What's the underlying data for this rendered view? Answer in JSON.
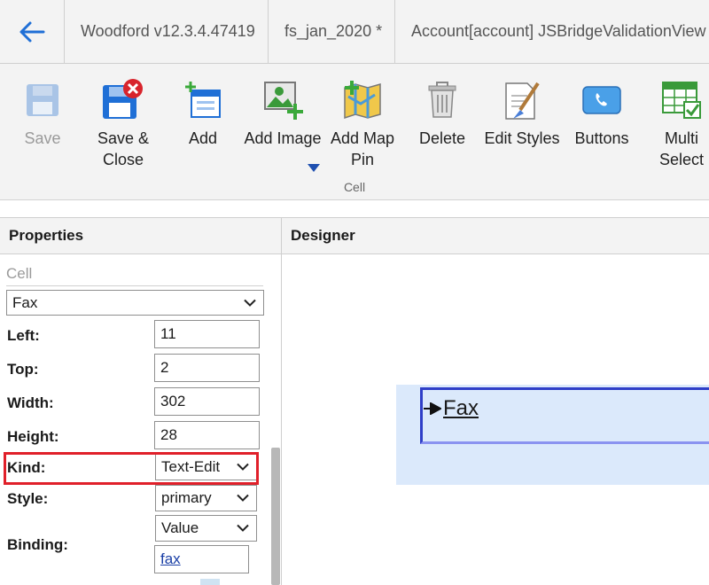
{
  "topbar": {
    "breadcrumbs": [
      "Woodford v12.3.4.47419",
      "fs_jan_2020 *",
      "Account[account] JSBridgeValidationView"
    ]
  },
  "ribbon": {
    "buttons": [
      {
        "label": "Save",
        "icon": "save-icon",
        "enabled": false
      },
      {
        "label": "Save & Close",
        "icon": "save-close-icon",
        "enabled": true
      },
      {
        "label": "Add",
        "icon": "add-icon",
        "enabled": true
      },
      {
        "label": "Add Image",
        "icon": "add-image-icon",
        "enabled": true
      },
      {
        "label": "Add Map Pin",
        "icon": "add-map-pin-icon",
        "enabled": true
      },
      {
        "label": "Delete",
        "icon": "delete-icon",
        "enabled": true
      },
      {
        "label": "Edit Styles",
        "icon": "edit-styles-icon",
        "enabled": true
      },
      {
        "label": "Buttons",
        "icon": "buttons-icon",
        "enabled": true
      },
      {
        "label": "Multi Select",
        "icon": "multi-select-icon",
        "enabled": true
      }
    ],
    "group_label": "Cell"
  },
  "properties": {
    "header": "Properties",
    "section": "Cell",
    "cell_select": "Fax",
    "fields": {
      "left": {
        "label": "Left:",
        "value": "11"
      },
      "top": {
        "label": "Top:",
        "value": "2"
      },
      "width": {
        "label": "Width:",
        "value": "302"
      },
      "height": {
        "label": "Height:",
        "value": "28"
      },
      "kind": {
        "label": "Kind:",
        "value": "Text-Edit"
      },
      "style": {
        "label": "Style:",
        "value": "primary"
      },
      "binding": {
        "label": "Binding:",
        "value": "Value",
        "field": "fax"
      }
    }
  },
  "designer": {
    "header": "Designer",
    "field_label": "Fax"
  },
  "colors": {
    "accent": "#2f3fc8",
    "highlight": "#e0202a",
    "cell_background": "#dbe9fb"
  }
}
